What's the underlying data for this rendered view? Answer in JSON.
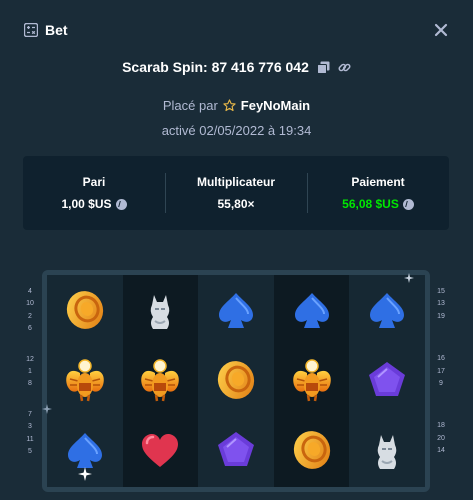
{
  "modal": {
    "title": "Bet",
    "icons": {
      "title": "bet-receipt-icon",
      "close": "close-icon"
    }
  },
  "game": {
    "id_text": "Scarab Spin: 87 416 776 042",
    "copy_icon": "copy-icon",
    "link_icon": "link-icon"
  },
  "placed": {
    "prefix": "Placé par",
    "user": "FeyNoMain",
    "user_icon": "star-icon"
  },
  "date_text": "activé 02/05/2022 à 19:34",
  "stats": {
    "bet_label": "Pari",
    "bet_value": "1,00 $US",
    "multiplier_label": "Multiplicateur",
    "multiplier_value": "55,80×",
    "payout_label": "Paiement",
    "payout_value": "56,08 $US",
    "currency_icon": "coin-icon",
    "colors": {
      "payout": "#00e701"
    }
  },
  "board": {
    "paylines_left": [
      "4",
      "10",
      "2",
      "6",
      "12",
      "1",
      "8",
      "7",
      "3",
      "11",
      "5"
    ],
    "paylines_right": [
      "15",
      "13",
      "19",
      "16",
      "17",
      "9",
      "18",
      "20",
      "14"
    ],
    "grid": [
      [
        "coin",
        "wolf",
        "spade",
        "spade",
        "spade"
      ],
      [
        "scarab",
        "scarab",
        "coin",
        "scarab",
        "pentagon"
      ],
      [
        "spade",
        "heart",
        "pentagon",
        "coin",
        "wolf"
      ]
    ]
  }
}
